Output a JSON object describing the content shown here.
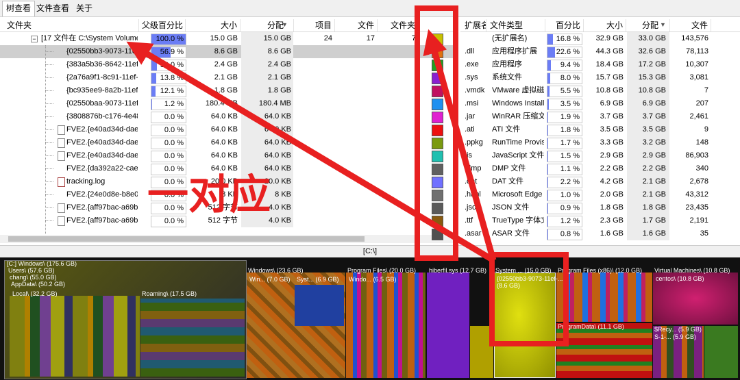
{
  "tabs": [
    "树查看",
    "文件查看",
    "关于"
  ],
  "tree": {
    "columns": [
      "文件夹",
      "父级百分比",
      "大小",
      "分配",
      "项目",
      "文件",
      "文件夹"
    ],
    "rows": [
      {
        "name": "[17 文件在 C:\\System Volume",
        "pct": "100.0 %",
        "pct_value": 100.0,
        "size": "15.0 GB",
        "alloc": "15.0 GB",
        "items": "24",
        "files": "17",
        "folders": "7",
        "level": 0,
        "icon": "folder"
      },
      {
        "name": "{02550bb3-9073-11ef-",
        "pct": "56.9 %",
        "pct_value": 56.9,
        "size": "8.6 GB",
        "alloc": "8.6 GB",
        "items": "",
        "files": "",
        "folders": "",
        "level": 1,
        "icon": "none",
        "selected": true
      },
      {
        "name": "{383a5b36-8642-11ef-",
        "pct": "16.0 %",
        "pct_value": 16.0,
        "size": "2.4 GB",
        "alloc": "2.4 GB",
        "items": "",
        "files": "",
        "folders": "",
        "level": 1,
        "icon": "none"
      },
      {
        "name": "{2a76a9f1-8c91-11ef-b",
        "pct": "13.8 %",
        "pct_value": 13.8,
        "size": "2.1 GB",
        "alloc": "2.1 GB",
        "items": "",
        "files": "",
        "folders": "",
        "level": 1,
        "icon": "none"
      },
      {
        "name": "{bc935ee9-8a2b-11ef-",
        "pct": "12.1 %",
        "pct_value": 12.1,
        "size": "1.8 GB",
        "alloc": "1.8 GB",
        "items": "",
        "files": "",
        "folders": "",
        "level": 1,
        "icon": "none"
      },
      {
        "name": "{02550baa-9073-11ef-",
        "pct": "1.2 %",
        "pct_value": 1.2,
        "size": "180.4 MB",
        "alloc": "180.4 MB",
        "items": "",
        "files": "",
        "folders": "",
        "level": 1,
        "icon": "none"
      },
      {
        "name": "{3808876b-c176-4e48-",
        "pct": "0.0 %",
        "pct_value": 0.0,
        "size": "64.0 KB",
        "alloc": "64.0 KB",
        "items": "",
        "files": "",
        "folders": "",
        "level": 1,
        "icon": "none"
      },
      {
        "name": "FVE2.{e40ad34d-dae9-",
        "pct": "0.0 %",
        "pct_value": 0.0,
        "size": "64.0 KB",
        "alloc": "64.0 KB",
        "items": "",
        "files": "",
        "folders": "",
        "level": 1,
        "icon": "file"
      },
      {
        "name": "FVE2.{e40ad34d-dae9-",
        "pct": "0.0 %",
        "pct_value": 0.0,
        "size": "64.0 KB",
        "alloc": "64.0 KB",
        "items": "",
        "files": "",
        "folders": "",
        "level": 1,
        "icon": "file"
      },
      {
        "name": "FVE2.{e40ad34d-dae9-",
        "pct": "0.0 %",
        "pct_value": 0.0,
        "size": "64.0 KB",
        "alloc": "64.0 KB",
        "items": "",
        "files": "",
        "folders": "",
        "level": 1,
        "icon": "file"
      },
      {
        "name": "FVE2.{da392a22-cae0-",
        "pct": "0.0 %",
        "pct_value": 0.0,
        "size": "64.0 KB",
        "alloc": "64.0 KB",
        "items": "",
        "files": "",
        "folders": "",
        "level": 1,
        "icon": "none"
      },
      {
        "name": "tracking.log",
        "pct": "0.0 %",
        "pct_value": 0.0,
        "size": "20.0 KB",
        "alloc": "20.0 KB",
        "items": "",
        "files": "",
        "folders": "",
        "level": 1,
        "icon": "log"
      },
      {
        "name": "FVE2.{24e0d8e-b8e0-",
        "pct": "0.0 %",
        "pct_value": 0.0,
        "size": "8 KB",
        "alloc": "8 KB",
        "items": "",
        "files": "",
        "folders": "",
        "level": 1,
        "icon": "none"
      },
      {
        "name": "FVE2.{aff97bac-a69b-4",
        "pct": "0.0 %",
        "pct_value": 0.0,
        "size": "512 字节",
        "alloc": "4.0 KB",
        "items": "",
        "files": "",
        "folders": "",
        "level": 1,
        "icon": "file"
      },
      {
        "name": "FVE2.{aff97bac-a69b-4",
        "pct": "0.0 %",
        "pct_value": 0.0,
        "size": "512 字节",
        "alloc": "4.0 KB",
        "items": "",
        "files": "",
        "folders": "",
        "level": 1,
        "icon": "file"
      }
    ]
  },
  "filetypes": {
    "columns": [
      "扩展名",
      "文件类型",
      "百分比",
      "大小",
      "分配",
      "文件"
    ],
    "rows": [
      {
        "ext": "",
        "type": "(无扩展名)",
        "pct": "16.8 %",
        "pct_value": 16.8,
        "size": "32.9 GB",
        "alloc": "33.0 GB",
        "files": "143,576",
        "color": "#c8c000"
      },
      {
        "ext": ".dll",
        "type": "应用程序扩展",
        "pct": "22.6 %",
        "pct_value": 22.6,
        "size": "44.3 GB",
        "alloc": "32.6 GB",
        "files": "78,113",
        "color": "#e07010"
      },
      {
        "ext": ".exe",
        "type": "应用程序",
        "pct": "9.4 %",
        "pct_value": 9.4,
        "size": "18.4 GB",
        "alloc": "17.2 GB",
        "files": "10,307",
        "color": "#20a020"
      },
      {
        "ext": ".sys",
        "type": "系统文件",
        "pct": "8.0 %",
        "pct_value": 8.0,
        "size": "15.7 GB",
        "alloc": "15.3 GB",
        "files": "3,081",
        "color": "#8a20d0"
      },
      {
        "ext": ".vmdk",
        "type": "VMware 虚拟磁",
        "pct": "5.5 %",
        "pct_value": 5.5,
        "size": "10.8 GB",
        "alloc": "10.8 GB",
        "files": "7",
        "color": "#c01060"
      },
      {
        "ext": ".msi",
        "type": "Windows Installe",
        "pct": "3.5 %",
        "pct_value": 3.5,
        "size": "6.9 GB",
        "alloc": "6.9 GB",
        "files": "207",
        "color": "#2090f0"
      },
      {
        "ext": ".jar",
        "type": "WinRAR 压缩文",
        "pct": "1.9 %",
        "pct_value": 1.9,
        "size": "3.7 GB",
        "alloc": "3.7 GB",
        "files": "2,461",
        "color": "#e020d0"
      },
      {
        "ext": ".ati",
        "type": "ATI 文件",
        "pct": "1.8 %",
        "pct_value": 1.8,
        "size": "3.5 GB",
        "alloc": "3.5 GB",
        "files": "9",
        "color": "#ee1010"
      },
      {
        "ext": ".ppkg",
        "type": "RunTime Provisi",
        "pct": "1.7 %",
        "pct_value": 1.7,
        "size": "3.3 GB",
        "alloc": "3.2 GB",
        "files": "148",
        "color": "#7a9a10"
      },
      {
        "ext": ".js",
        "type": "JavaScript 文件",
        "pct": "1.5 %",
        "pct_value": 1.5,
        "size": "2.9 GB",
        "alloc": "2.9 GB",
        "files": "86,903",
        "color": "#20c0b0"
      },
      {
        "ext": ".dmp",
        "type": "DMP 文件",
        "pct": "1.1 %",
        "pct_value": 1.1,
        "size": "2.2 GB",
        "alloc": "2.2 GB",
        "files": "340",
        "color": "#606060"
      },
      {
        "ext": ".dat",
        "type": "DAT 文件",
        "pct": "2.2 %",
        "pct_value": 2.2,
        "size": "4.2 GB",
        "alloc": "2.1 GB",
        "files": "2,678",
        "color": "#7070ff"
      },
      {
        "ext": ".html",
        "type": "Microsoft Edge I",
        "pct": "1.0 %",
        "pct_value": 1.0,
        "size": "2.0 GB",
        "alloc": "2.1 GB",
        "files": "43,312",
        "color": "#707070"
      },
      {
        "ext": ".json",
        "type": "JSON 文件",
        "pct": "0.9 %",
        "pct_value": 0.9,
        "size": "1.8 GB",
        "alloc": "1.8 GB",
        "files": "23,435",
        "color": "#5a5a5a"
      },
      {
        "ext": ".ttf",
        "type": "TrueType 字体文",
        "pct": "1.2 %",
        "pct_value": 1.2,
        "size": "2.3 GB",
        "alloc": "1.7 GB",
        "files": "2,191",
        "color": "#8a5a10"
      },
      {
        "ext": ".asar",
        "type": "ASAR 文件",
        "pct": "0.8 %",
        "pct_value": 0.8,
        "size": "1.6 GB",
        "alloc": "1.6 GB",
        "files": "35",
        "color": "#505050"
      }
    ]
  },
  "path_label": "[C:\\]",
  "annotation": "一对应",
  "treemap_labels": [
    "[C:] Windows\\ (175.6 GB)",
    "Users\\ (57.6 GB)",
    "chang\\ (55.0 GB)",
    "AppData\\ (50.2 GB)",
    "Local\\ (32.2 GB)",
    "Roaming\\ (17.5 GB)",
    "Windows\\ (23.6 GB)",
    "Win... (7.0 GB)",
    "Syst... (6.9 GB)",
    "Program Files\\ (20.0 GB)",
    "Windo... (6.5 GB)",
    "hiberfil.sys (12.7 GB)",
    "System ... (15.0 GB)",
    "{02550bb3-9073-11ef-...",
    "(8.6 GB)",
    "Program Files (x86)\\ (12.0 GB)",
    "Virtual Machines\\ (10.8 GB)",
    "centos\\ (10.8 GB)",
    "ProgramData\\ (11.1 GB)",
    "$Recy... (5.9 GB)",
    "S-1-... (5.9 GB)"
  ],
  "colors": {
    "selection_box": "#e82020",
    "bar_fill": "#6b7df5"
  }
}
